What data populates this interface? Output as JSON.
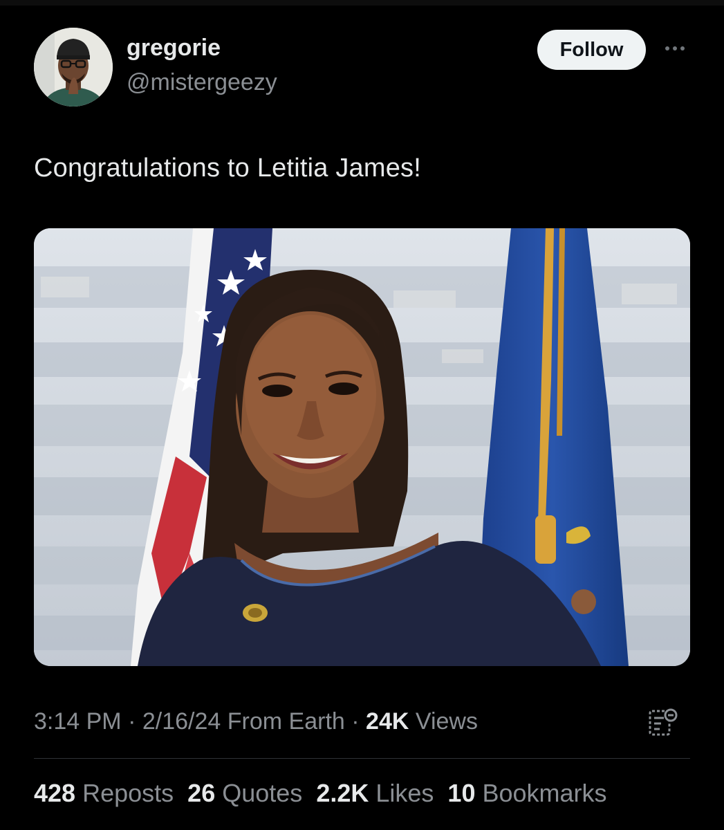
{
  "author": {
    "name": "gregorie",
    "handle": "@mistergeezy",
    "follow_label": "Follow",
    "more_icon": "more-horizontal-icon"
  },
  "tweet": {
    "text": "Congratulations to Letitia James!",
    "meta": {
      "time": "3:14 PM",
      "date": "2/16/24",
      "source": "From Earth",
      "views_count": "24K",
      "views_label": "Views",
      "separator": "·"
    }
  },
  "stats": [
    {
      "count": "428",
      "label": "Reposts"
    },
    {
      "count": "26",
      "label": "Quotes"
    },
    {
      "count": "2.2K",
      "label": "Likes"
    },
    {
      "count": "10",
      "label": "Bookmarks"
    }
  ],
  "colors": {
    "background": "#000000",
    "text_primary": "#e7e9ea",
    "text_secondary": "#8b8f94",
    "follow_bg": "#eff3f4",
    "divider": "#2f3336"
  },
  "icons": {
    "analytics": "analytics-icon"
  }
}
